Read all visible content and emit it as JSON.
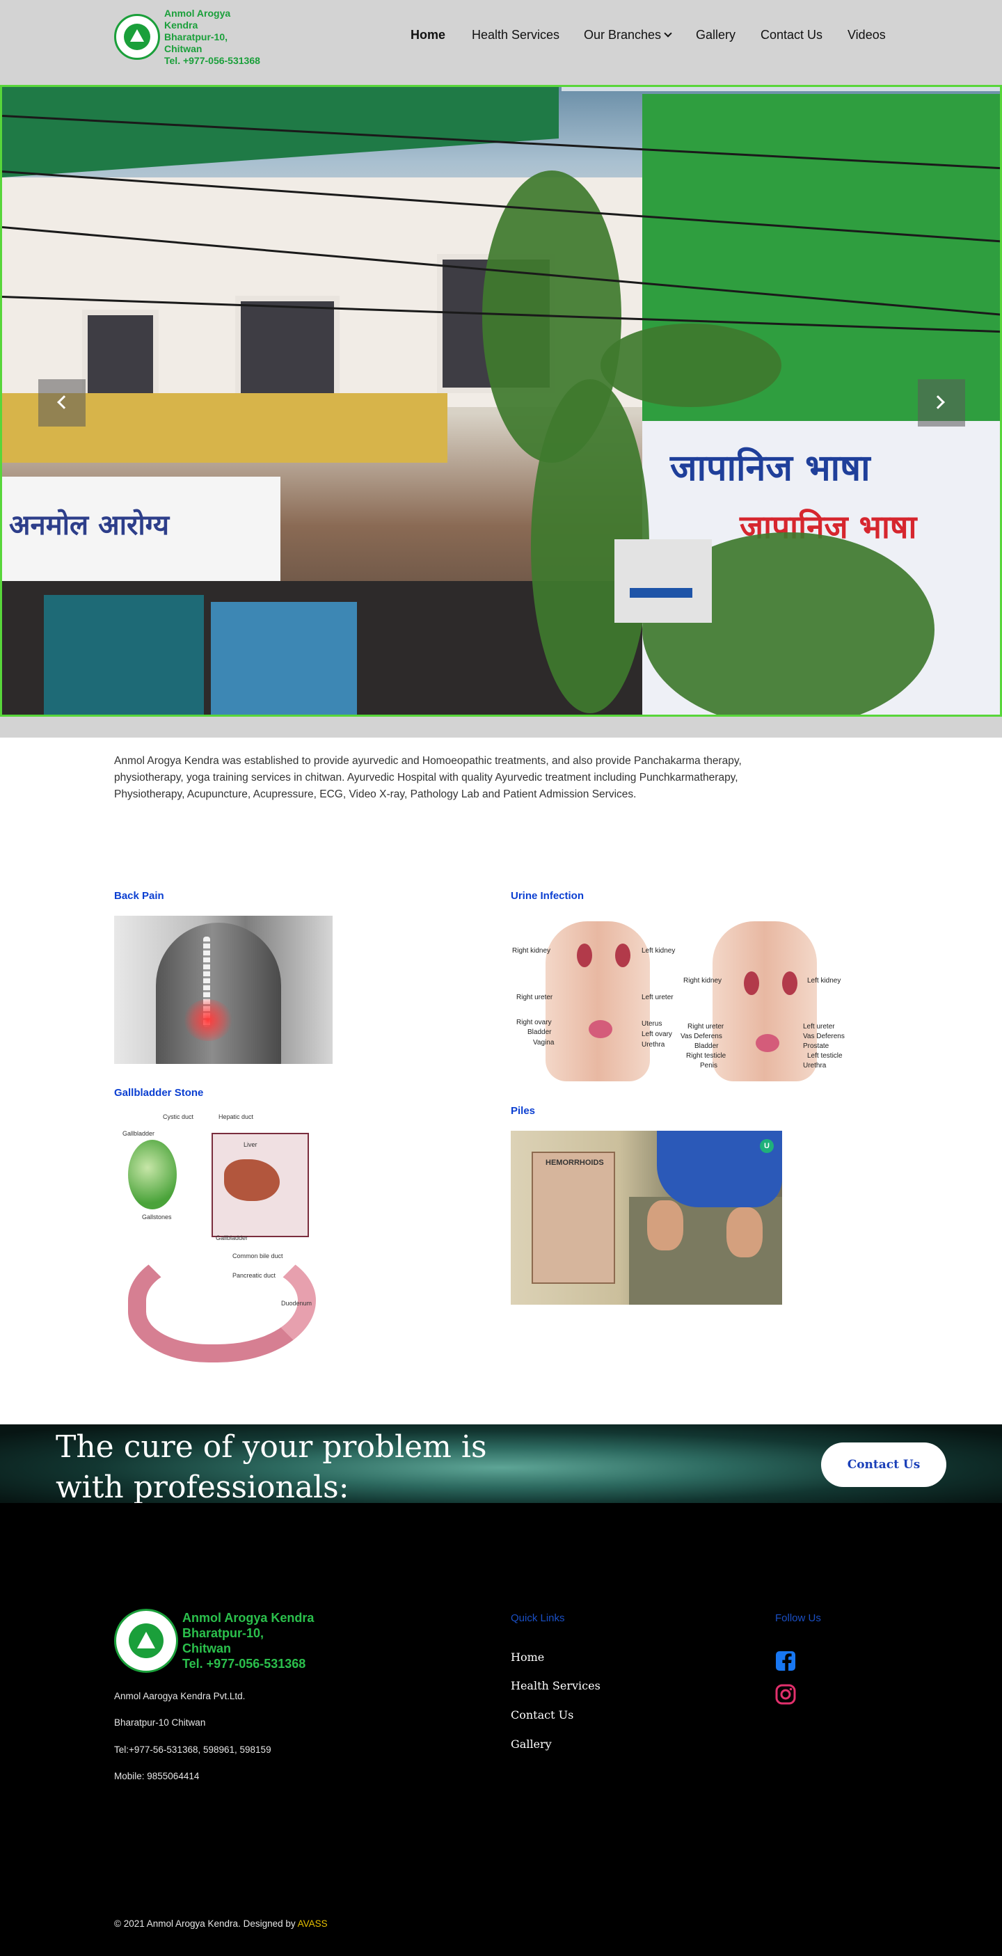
{
  "header": {
    "logo_line1": "Anmol Arogya Kendra",
    "logo_line2": "Bharatpur-10, Chitwan",
    "logo_line3": "Tel. +977-056-531368",
    "nav": {
      "home": "Home",
      "health_services": "Health Services",
      "our_branches": "Our Branches",
      "gallery": "Gallery",
      "contact_us": "Contact Us",
      "videos": "Videos"
    }
  },
  "hero": {
    "slide_text_blue": "जापानिज भाषा",
    "slide_text_red": "जापानिज भाषा",
    "slide_text_left": "अनमोल आरोग्य"
  },
  "intro": {
    "text": "Anmol Arogya Kendra was established to provide ayurvedic and Homoeopathic treatments, and also provide Panchakarma therapy, physiotherapy, yoga training services in chitwan. Ayurvedic Hospital with quality Ayurvedic treatment including Punchkarmatherapy, Physiotherapy, Acupuncture, Acupressure, ECG, Video X-ray, Pathology Lab and Patient Admission Services."
  },
  "conditions": {
    "back_pain": "Back Pain",
    "urine_infection": "Urine Infection",
    "gallbladder_stone": "Gallbladder Stone",
    "piles": "Piles",
    "urine_labels": {
      "right_kidney": "Right kidney",
      "left_kidney": "Left kidney",
      "right_ureter": "Right ureter",
      "left_ureter": "Left ureter",
      "right_ovary": "Right ovary",
      "left_ovary": "Left ovary",
      "bladder": "Bladder",
      "uterus": "Uterus",
      "vagina": "Vagina",
      "urethra": "Urethra",
      "vas_deferens": "Vas Deferens",
      "prostate": "Prostate",
      "right_testicle": "Right testicle",
      "left_testicle": "Left testicle",
      "penis": "Penis"
    },
    "gall_labels": {
      "cystic_duct": "Cystic duct",
      "hepatic_duct": "Hepatic duct",
      "gallbladder": "Gallbladder",
      "liver": "Liver",
      "gallstones": "Gallstones",
      "common_bile_duct": "Common bile duct",
      "pancreatic_duct": "Pancreatic duct",
      "duodenum": "Duodenum"
    },
    "piles_title": "HEMORRHOIDS"
  },
  "cta": {
    "text_line1": "The cure of your problem is",
    "text_line2": "with professionals:",
    "button": "Contact Us"
  },
  "footer": {
    "logo_line1": "Anmol Arogya Kendra",
    "logo_line2": "Bharatpur-10, Chitwan",
    "logo_line3": "Tel. +977-056-531368",
    "company": "Anmol Aarogya Kendra Pvt.Ltd.",
    "address": "Bharatpur-10 Chitwan",
    "tel": "Tel:+977-56-531368, 598961, 598159",
    "mobile": "Mobile: 9855064414",
    "quick_links_title": "Quick Links",
    "links": {
      "home": "Home",
      "health_services": "Health Services",
      "contact_us": "Contact Us",
      "gallery": "Gallery"
    },
    "follow_title": "Follow Us",
    "copyright": "© 2021 Anmol Arogya Kendra. Designed by ",
    "designer": "AVASS"
  },
  "colors": {
    "brand_green": "#1a9f3a",
    "link_blue": "#0b3fd1",
    "facebook": "#1877f2",
    "instagram": "#e1306c",
    "designer_yellow": "#e8c100",
    "hero_border": "#58d63a"
  },
  "icons": [
    "logo-seal-icon",
    "chevron-down-icon",
    "chevron-left-icon",
    "chevron-right-icon",
    "facebook-icon",
    "instagram-icon"
  ]
}
